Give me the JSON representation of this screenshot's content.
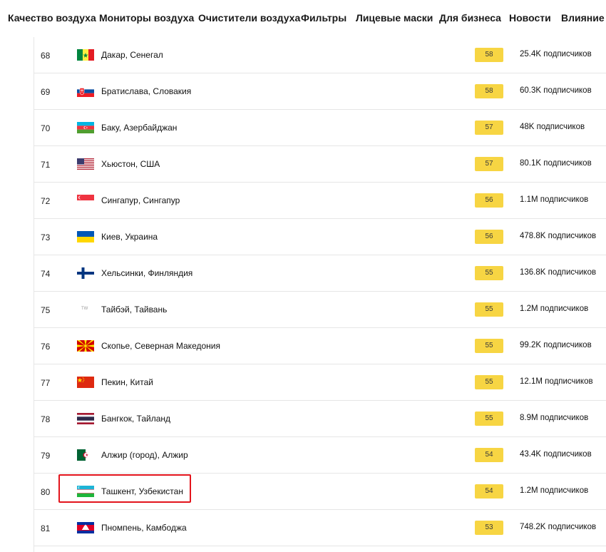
{
  "nav": {
    "items": [
      "Качество воздуха",
      "Мониторы воздуха",
      "Очистители воздуха",
      "Фильтры",
      "Лицевые маски",
      "Для бизнеса",
      "Новости",
      "Влияние"
    ]
  },
  "rows": [
    {
      "rank": "68",
      "city": "Дакар, Сенегал",
      "aqi": "58",
      "followers": "25.4K подписчиков",
      "flag": "senegal-flag-icon"
    },
    {
      "rank": "69",
      "city": "Братислава, Словакия",
      "aqi": "58",
      "followers": "60.3K подписчиков",
      "flag": "slovakia-flag-icon"
    },
    {
      "rank": "70",
      "city": "Баку, Азербайджан",
      "aqi": "57",
      "followers": "48K подписчиков",
      "flag": "azerbaijan-flag-icon"
    },
    {
      "rank": "71",
      "city": "Хьюстон, США",
      "aqi": "57",
      "followers": "80.1K подписчиков",
      "flag": "usa-flag-icon"
    },
    {
      "rank": "72",
      "city": "Сингапур, Сингапур",
      "aqi": "56",
      "followers": "1.1M подписчиков",
      "flag": "singapore-flag-icon"
    },
    {
      "rank": "73",
      "city": "Киев, Украина",
      "aqi": "56",
      "followers": "478.8K подписчиков",
      "flag": "ukraine-flag-icon"
    },
    {
      "rank": "74",
      "city": "Хельсинки, Финляндия",
      "aqi": "55",
      "followers": "136.8K подписчиков",
      "flag": "finland-flag-icon"
    },
    {
      "rank": "75",
      "city": "Тайбэй, Тайвань",
      "aqi": "55",
      "followers": "1.2M подписчиков",
      "flag": "taiwan-flag-icon",
      "flag_text": "TW"
    },
    {
      "rank": "76",
      "city": "Скопье, Северная Македония",
      "aqi": "55",
      "followers": "99.2K подписчиков",
      "flag": "north-macedonia-flag-icon"
    },
    {
      "rank": "77",
      "city": "Пекин, Китай",
      "aqi": "55",
      "followers": "12.1M подписчиков",
      "flag": "china-flag-icon"
    },
    {
      "rank": "78",
      "city": "Бангкок, Тайланд",
      "aqi": "55",
      "followers": "8.9M подписчиков",
      "flag": "thailand-flag-icon"
    },
    {
      "rank": "79",
      "city": "Алжир (город), Алжир",
      "aqi": "54",
      "followers": "43.4K подписчиков",
      "flag": "algeria-flag-icon"
    },
    {
      "rank": "80",
      "city": "Ташкент, Узбекистан",
      "aqi": "54",
      "followers": "1.2M подписчиков",
      "flag": "uzbekistan-flag-icon"
    },
    {
      "rank": "81",
      "city": "Пномпень, Камбоджа",
      "aqi": "53",
      "followers": "748.2K подписчиков",
      "flag": "cambodia-flag-icon"
    }
  ],
  "colors": {
    "aqi_badge": "#f7d543",
    "highlight": "#e3141c",
    "divider": "#e6e6e6"
  }
}
